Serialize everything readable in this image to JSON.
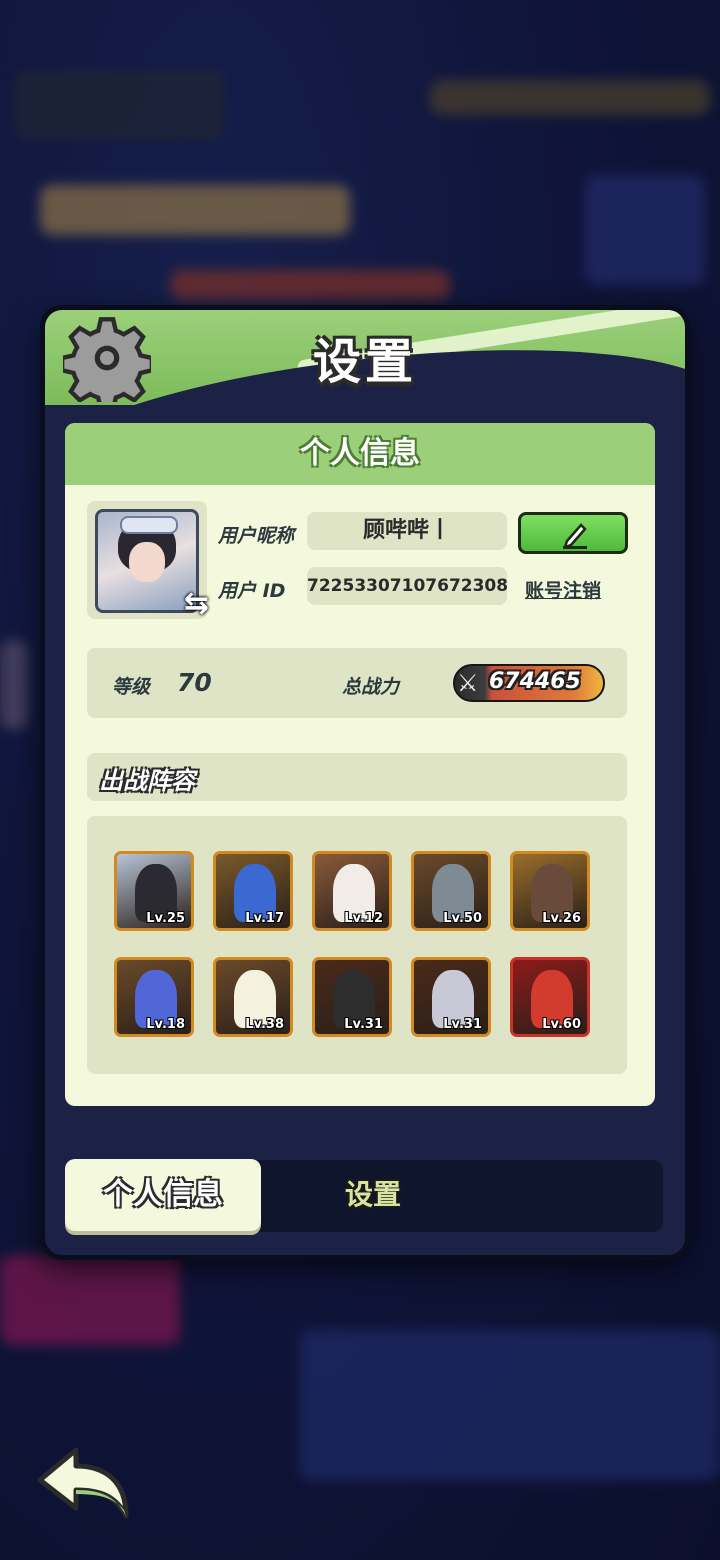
{
  "panel": {
    "title": "设置"
  },
  "profile": {
    "section_title": "个人信息",
    "nickname_label": "用户昵称",
    "nickname_value": "顾哔哔丨",
    "id_label": "用户 ID",
    "id_value": "72253307107672308",
    "logout_link": "账号注销",
    "level_label": "等级",
    "level_value": "70",
    "power_label": "总战力",
    "power_value": "674465",
    "team_title": "出战阵容"
  },
  "team": [
    {
      "level": "Lv.25",
      "color": "#b7c4d8",
      "fig": "#2b2a33"
    },
    {
      "level": "Lv.17",
      "color": "#7a5a2a",
      "fig": "#3a6ad1"
    },
    {
      "level": "Lv.12",
      "color": "#8a5a3a",
      "fig": "#f1ece8"
    },
    {
      "level": "Lv.50",
      "color": "#6b4a2a",
      "fig": "#7e8b95"
    },
    {
      "level": "Lv.26",
      "color": "#9a6d2c",
      "fig": "#6a4b3b"
    },
    {
      "level": "Lv.18",
      "color": "#6a4a2a",
      "fig": "#5167d8"
    },
    {
      "level": "Lv.38",
      "color": "#6a4a2a",
      "fig": "#f4f1df"
    },
    {
      "level": "Lv.31",
      "color": "#4a2a1a",
      "fig": "#2e2d2e"
    },
    {
      "level": "Lv.31",
      "color": "#4a2a1a",
      "fig": "#c8c8d6"
    },
    {
      "level": "Lv.60",
      "color": "#8c1b1b",
      "fig": "#d23b2e"
    }
  ],
  "tabs": {
    "active": "个人信息",
    "inactive": "设置"
  },
  "icons": {
    "gear": "gear-icon",
    "edit": "pencil-icon",
    "swap": "swap-icon",
    "back": "back-arrow-icon"
  }
}
